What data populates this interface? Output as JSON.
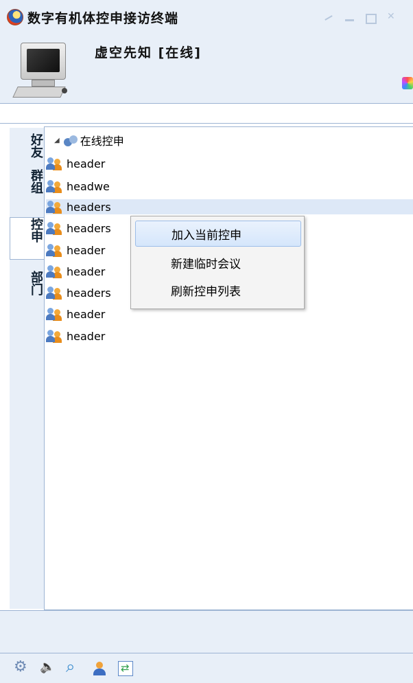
{
  "window": {
    "title": "数字有机体控申接访终端"
  },
  "profile": {
    "username": "虚空先知 [在线]"
  },
  "tabs": [
    {
      "label": "好友",
      "active": false
    },
    {
      "label": "群组",
      "active": false
    },
    {
      "label": "控申",
      "active": true
    },
    {
      "label": "部门",
      "active": false
    }
  ],
  "tree": {
    "group_label": "在线控申",
    "items": [
      {
        "label": "header",
        "selected": false
      },
      {
        "label": "headwe",
        "selected": false
      },
      {
        "label": "headers",
        "selected": true
      },
      {
        "label": "headers",
        "selected": false
      },
      {
        "label": "header",
        "selected": false
      },
      {
        "label": "header",
        "selected": false
      },
      {
        "label": "headers",
        "selected": false
      },
      {
        "label": "header",
        "selected": false
      },
      {
        "label": "header",
        "selected": false
      }
    ]
  },
  "context_menu": {
    "items": [
      {
        "label": "加入当前控申",
        "highlighted": true
      },
      {
        "label": "新建临时会议",
        "highlighted": false
      },
      {
        "label": "刷新控申列表",
        "highlighted": false
      }
    ]
  },
  "toolbar": {
    "icons": [
      "gear-icon",
      "speaker-icon",
      "magnifier-icon",
      "user-icon",
      "refresh-icon"
    ]
  },
  "colors": {
    "panel_bg": "#e8eff8",
    "border": "#9db4d3",
    "selection": "#dde8f7"
  }
}
